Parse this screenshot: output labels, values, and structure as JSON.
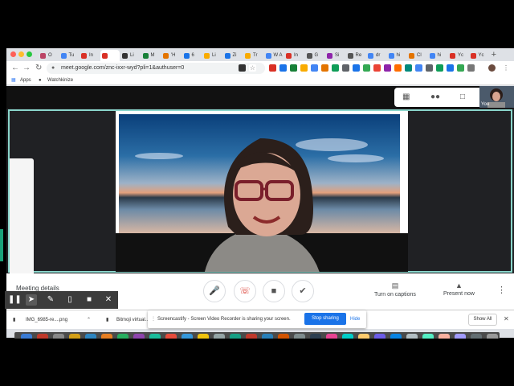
{
  "browser": {
    "tabs": [
      {
        "label": "O",
        "color": "#b46"
      },
      {
        "label": "Tu",
        "color": "#4285f4"
      },
      {
        "label": "In",
        "color": "#d93025"
      },
      {
        "label": "",
        "color": "#d93025",
        "active": true
      },
      {
        "label": "Li",
        "color": "#333"
      },
      {
        "label": "M",
        "color": "#188038"
      },
      {
        "label": "'H",
        "color": "#e37400"
      },
      {
        "label": "6",
        "color": "#1a73e8"
      },
      {
        "label": "Li",
        "color": "#f9ab00"
      },
      {
        "label": "Zi",
        "color": "#1a73e8"
      },
      {
        "label": "Tr",
        "color": "#f9ab00"
      },
      {
        "label": "W A",
        "color": "#4285f4"
      },
      {
        "label": "In",
        "color": "#d93025"
      },
      {
        "label": "G",
        "color": "#555"
      },
      {
        "label": "Si",
        "color": "#8e24aa"
      },
      {
        "label": "Re",
        "color": "#555"
      },
      {
        "label": "dr",
        "color": "#4285f4"
      },
      {
        "label": "hi",
        "color": "#4285f4"
      },
      {
        "label": "Cl",
        "color": "#e37400"
      },
      {
        "label": "hi",
        "color": "#4285f4"
      },
      {
        "label": "Yc",
        "color": "#d93025"
      },
      {
        "label": "Yc",
        "color": "#d93025"
      }
    ],
    "new_tab_glyph": "+",
    "url": "meet.google.com/znc-ixxr-wyd?pli=1&authuser=0",
    "bookmarks": [
      "Apps",
      "Watchkinize"
    ]
  },
  "meet": {
    "self_label": "You",
    "meeting_details_label": "Meeting details",
    "bottom_controls": {
      "captions_label": "Turn on captions",
      "present_label": "Present now"
    }
  },
  "downloads": {
    "items": [
      "IMG_6985-re....png",
      "Bitmoji virtual..."
    ],
    "show_all_label": "Show All"
  },
  "share_bar": {
    "message": "Screencastify - Screen Video Recorder is sharing your screen.",
    "stop_label": "Stop sharing",
    "hide_label": "Hide"
  },
  "colors": {
    "meet_border": "#8ad6cb",
    "stop_button": "#1a73e8",
    "hangup": "#d93025"
  }
}
